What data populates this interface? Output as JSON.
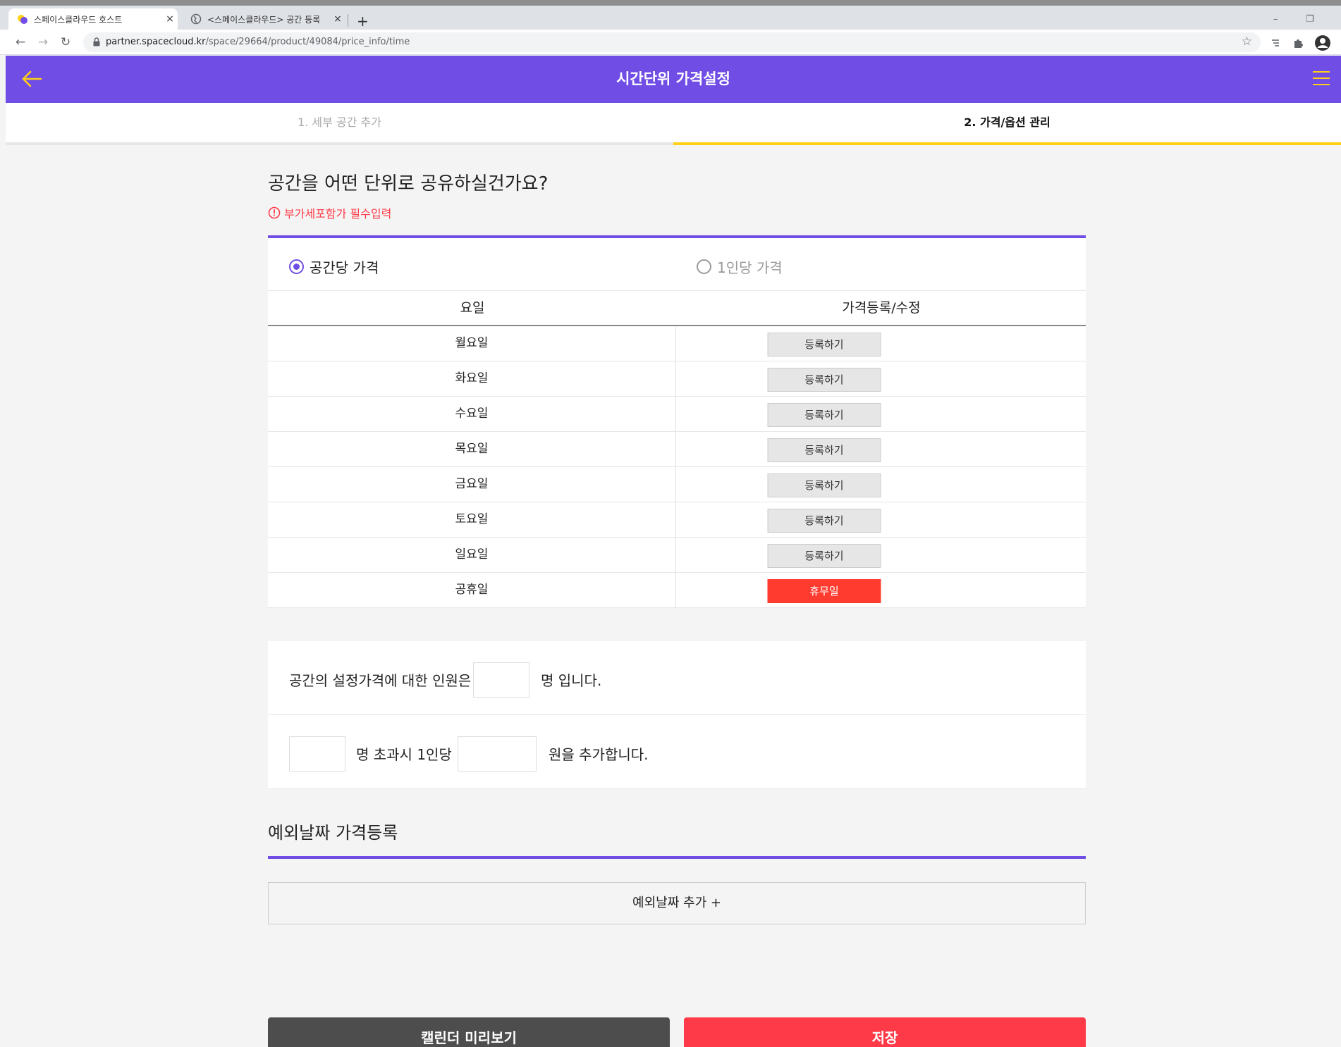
{
  "browser": {
    "tabs": [
      {
        "title": "스페이스클라우드 호스트",
        "close": "×"
      },
      {
        "title": "<스페이스클라우드> 공간 등록",
        "close": "×"
      }
    ],
    "new_tab": "+",
    "window_controls": {
      "minimize": "–",
      "restore": "❐",
      "close": "✕"
    },
    "url_host": "partner.spacecloud.kr",
    "url_path": "/space/29664/product/49084/price_info/time",
    "nav": {
      "back": "←",
      "forward": "→",
      "reload": "↻"
    },
    "star": "☆"
  },
  "header": {
    "title": "시간단위 가격설정",
    "colors": {
      "brand": "#704de4",
      "accent": "#ffd014"
    }
  },
  "steps": [
    {
      "label": "1. 세부 공간 추가"
    },
    {
      "label": "2. 가격/옵션 관리"
    }
  ],
  "question": {
    "title": "공간을 어떤 단위로 공유하실건가요?",
    "note": "부가세포함가 필수입력"
  },
  "pricing_mode": {
    "options": [
      {
        "label": "공간당 가격",
        "selected": true
      },
      {
        "label": "1인당 가격",
        "selected": false
      }
    ]
  },
  "table": {
    "headers": [
      "요일",
      "가격등록/수정"
    ],
    "rows": [
      {
        "day": "월요일",
        "action": "등록하기"
      },
      {
        "day": "화요일",
        "action": "등록하기"
      },
      {
        "day": "수요일",
        "action": "등록하기"
      },
      {
        "day": "목요일",
        "action": "등록하기"
      },
      {
        "day": "금요일",
        "action": "등록하기"
      },
      {
        "day": "토요일",
        "action": "등록하기"
      },
      {
        "day": "일요일",
        "action": "등록하기"
      },
      {
        "day": "공휴일",
        "action": "휴무일"
      }
    ]
  },
  "people": {
    "line1_prefix": "공간의 설정가격에 대한 인원은",
    "line1_suffix": "명 입니다.",
    "base_people_value": "",
    "line2_mid": "명 초과시 1인당",
    "line2_suffix": "원을 추가합니다.",
    "exceed_people_value": "",
    "extra_price_value": ""
  },
  "exception": {
    "title": "예외날짜 가격등록",
    "add_label": "예외날짜 추가 +"
  },
  "buttons": {
    "preview": "캘린더 미리보기",
    "save": "저장"
  }
}
